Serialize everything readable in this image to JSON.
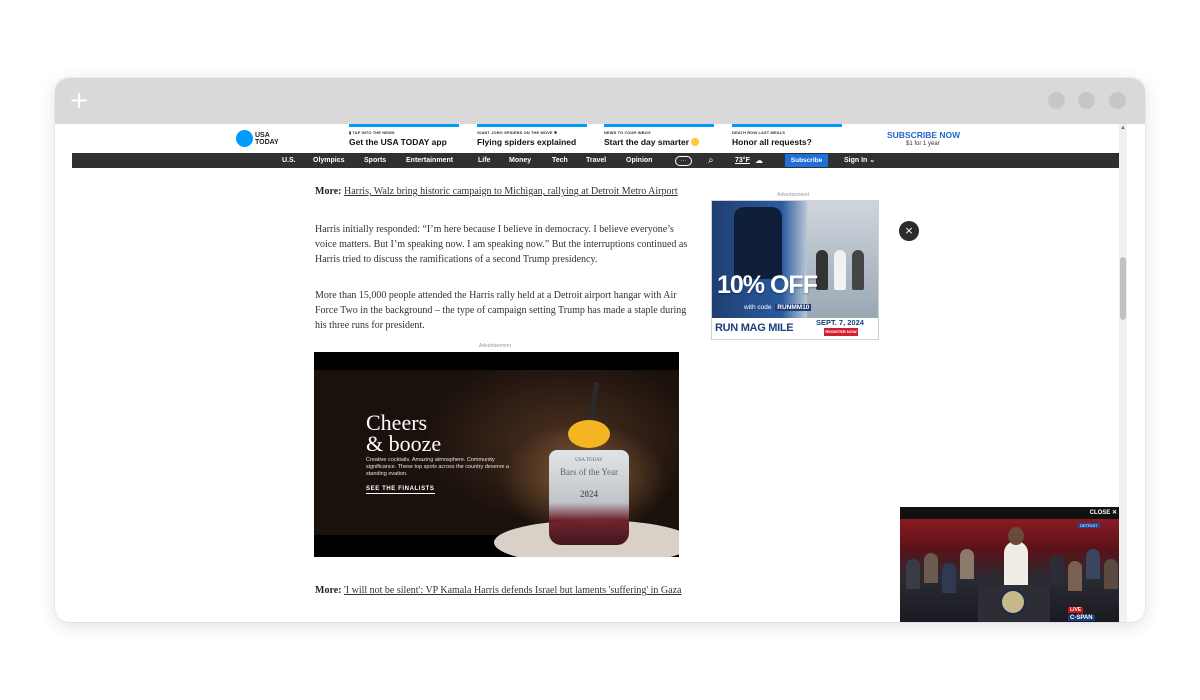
{
  "window": {
    "new_tab_label": "+"
  },
  "masthead": {
    "logo_line1": "USA",
    "logo_line2": "TODAY",
    "promos": [
      {
        "kicker": "TAP INTO THE NEWS",
        "headline": "Get the USA TODAY app"
      },
      {
        "kicker": "GIANT JORO SPIDERS ON THE MOVE",
        "headline": "Flying spiders explained"
      },
      {
        "kicker": "NEWS TO YOUR INBOX",
        "headline": "Start the day smarter"
      },
      {
        "kicker": "DEATH ROW LAST MEALS",
        "headline": "Honor all requests?"
      }
    ],
    "subscribe_label": "SUBSCRIBE NOW",
    "subscribe_price": "$1 for 1 year"
  },
  "nav": {
    "items": [
      "U.S.",
      "Olympics",
      "Sports",
      "Entertainment",
      "Life",
      "Money",
      "Tech",
      "Travel",
      "Opinion"
    ],
    "more_label": "···",
    "weather": "73°F",
    "subscribe_label": "Subscribe",
    "signin_label": "Sign In ⌄"
  },
  "article": {
    "more1_prefix": "More:",
    "more1_link": "Harris, Walz bring historic campaign to Michigan, rallying at Detroit Metro Airport",
    "para1": "Harris initially responded: “I’m here because I believe in democracy. I believe everyone’s voice matters. But I’m speaking now. I am speaking now.” But the interruptions continued as Harris tried to discuss the ramifications of a second Trump presidency.",
    "para2": "More than 15,000 people attended the Harris rally held at a Detroit airport hangar with Air Force Two in the background – the type of campaign setting Trump has made a staple during his three runs for president.",
    "more2_prefix": "More:",
    "more2_link": "'I will not be silent': VP Kamala Harris defends Israel but laments 'suffering' in Gaza"
  },
  "ads": {
    "label": "Advertisement",
    "bars": {
      "headline_line1": "Cheers",
      "headline_line2": "& booze",
      "subtext": "Creative cocktails. Amazing atmosphere. Community significance. These top spots across the country deserve a standing ovation.",
      "cta": "SEE THE FINALISTS",
      "glass_brand": "USA TODAY",
      "glass_title": "Bars of the Year",
      "glass_year": "2024"
    },
    "run": {
      "discount": "10% OFF",
      "code_prefix": "with code",
      "code": "RUNMM10",
      "brand": "RUN MAG MILE",
      "date": "SEPT. 7, 2024",
      "register": "REGISTER NOW"
    },
    "close_icon": "×"
  },
  "video": {
    "close_label": "CLOSE ✕",
    "badge": "DETROIT",
    "live": "LIVE",
    "network": "C-SPAN"
  }
}
